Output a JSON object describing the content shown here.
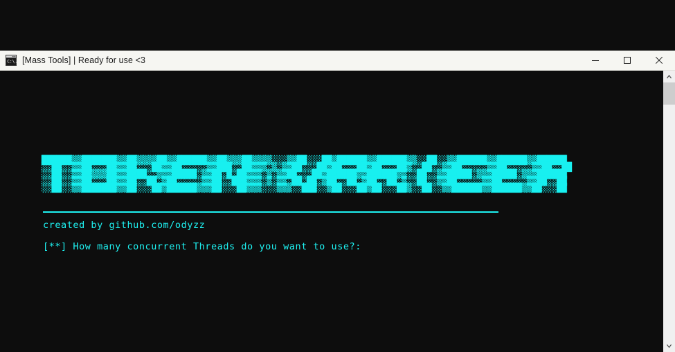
{
  "window": {
    "title": "[Mass Tools] | Ready for use <3",
    "icon": "cmd-console-icon",
    "minimize_label": "—",
    "maximize_label": "☐",
    "close_label": "✕"
  },
  "console": {
    "banner_text": "TOKEN: VERIFIER",
    "banner_art": "██████▒▒███████▒▒██▒▒▒▒██▒▒██████▒▒██▒▒▒██▒▒▒▒░░░▒▒██░░░██▒██████▒▒██████▒▒░░██░░▒▒██████▒▒██████▒▒██████\n░░██░░▒▒██░░░██▒▒██░░░██▒▒██░░░░░▒▒███░░██▒▒▒░▒░▒▒██░░░██▒██░░░██▒██░░░██▒░░██░░▒▒██░░░░░▒▒██░░░░░▒▒██░░██\n░░██░░▒▒██▒▒▒██▒▒████░░▒▒▒█████░▒▒██░█░██▒▒▒░▒░▒▒██░░░██▒██████▒▒██████▒▒░░██░░▒▒█████░▒▒▒█████░▒▒▒██████\n░░██░░▒▒██░░░██▒▒██░░██░▒██░░░░░▒▒██░░███▒▒▒░▒░▒▒░██░██░▒██░░██░▒██░░██░▒░░██░░▒▒██░░░░░▒▒██░░░░░▒▒██░░██\n░░██░░▒▒███████▒▒██░░░██▒██████▒▒▒██░░░██▒▒▒░░░▒▒▒░░███░░▒██░░░██▒██░░░██▒░░██░░▒▒██████▒▒██████▒▒██░░░██",
    "credit_line": "created by github.com/odyzz",
    "prompt_line": "[**] How many concurrent Threads do you want to use?:",
    "accent_color": "#1ef3f3",
    "background_color": "#0d0d0d"
  },
  "scrollbar": {
    "up_arrow": "▲",
    "down_arrow": "▼",
    "thumb_label": "scroll-thumb"
  }
}
